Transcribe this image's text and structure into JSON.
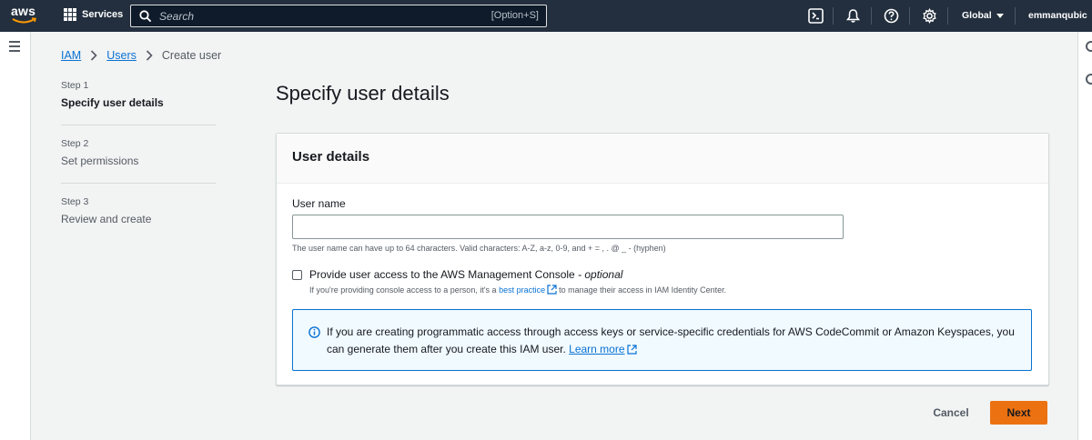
{
  "topnav": {
    "logo_text": "aws",
    "services_label": "Services",
    "search_placeholder": "Search",
    "search_shortcut": "[Option+S]",
    "region_label": "Global",
    "account_label": "emmanqubic",
    "icons": [
      "cloudshell-icon",
      "bell-icon",
      "help-icon",
      "gear-icon"
    ],
    "background_color": "#232f3e"
  },
  "breadcrumb": {
    "items": [
      "IAM",
      "Users"
    ],
    "current": "Create user"
  },
  "wizard": {
    "steps": [
      {
        "number": "Step 1",
        "title": "Specify user details",
        "active": true
      },
      {
        "number": "Step 2",
        "title": "Set permissions",
        "active": false
      },
      {
        "number": "Step 3",
        "title": "Review and create",
        "active": false
      }
    ]
  },
  "main": {
    "title": "Specify user details",
    "panel": {
      "header": "User details",
      "username_label": "User name",
      "username_value": "",
      "username_hint": "The user name can have up to 64 characters. Valid characters: A-Z, a-z, 0-9, and + = , . @ _ - (hyphen)",
      "console_access": {
        "label": "Provide user access to the AWS Management Console",
        "optional": "- optional",
        "checked": false,
        "desc_before": "If you're providing console access to a person, it's a",
        "desc_link": "best practice",
        "desc_after": "to manage their access in IAM Identity Center."
      },
      "info": {
        "text": "If you are creating programmatic access through access keys or service-specific credentials for AWS CodeCommit or Amazon Keyspaces, you can generate them after you create this IAM user.",
        "link": "Learn more"
      }
    }
  },
  "actions": {
    "cancel_label": "Cancel",
    "next_label": "Next",
    "primary_color": "#ec7211"
  },
  "colors": {
    "link": "#0972d3",
    "info_background": "#f1faff"
  }
}
